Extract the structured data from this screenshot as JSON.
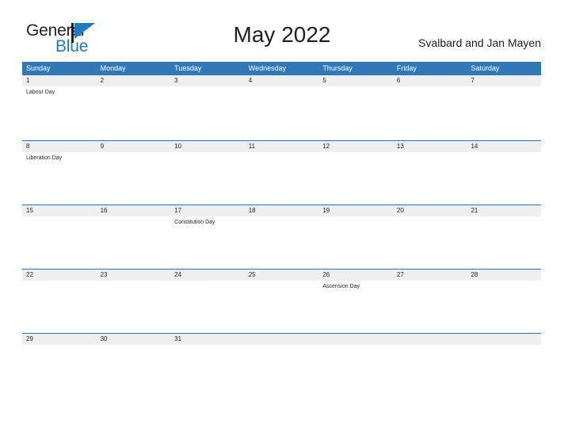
{
  "brand": {
    "name_part1": "General",
    "name_part2": "Blue",
    "flag_icon": "blue-flag-triangle-icon",
    "color_dark": "#231f20",
    "color_blue": "#1f7ac4"
  },
  "header": {
    "title": "May 2022",
    "region": "Svalbard and Jan Mayen"
  },
  "theme": {
    "header_blue": "#3079b6",
    "row_rule_blue": "#2e72ad",
    "daynum_background": "#efeff0",
    "page_background": "#ffffff",
    "text_color": "#231f20",
    "header_text_color": "#ffffff"
  },
  "calendar": {
    "weekdays": [
      "Sunday",
      "Monday",
      "Tuesday",
      "Wednesday",
      "Thursday",
      "Friday",
      "Saturday"
    ],
    "weeks": [
      {
        "days": [
          {
            "number": "1",
            "event": "Labour Day"
          },
          {
            "number": "2",
            "event": ""
          },
          {
            "number": "3",
            "event": ""
          },
          {
            "number": "4",
            "event": ""
          },
          {
            "number": "5",
            "event": ""
          },
          {
            "number": "6",
            "event": ""
          },
          {
            "number": "7",
            "event": ""
          }
        ]
      },
      {
        "days": [
          {
            "number": "8",
            "event": "Liberation Day"
          },
          {
            "number": "9",
            "event": ""
          },
          {
            "number": "10",
            "event": ""
          },
          {
            "number": "11",
            "event": ""
          },
          {
            "number": "12",
            "event": ""
          },
          {
            "number": "13",
            "event": ""
          },
          {
            "number": "14",
            "event": ""
          }
        ]
      },
      {
        "days": [
          {
            "number": "15",
            "event": ""
          },
          {
            "number": "16",
            "event": ""
          },
          {
            "number": "17",
            "event": "Constitution Day"
          },
          {
            "number": "18",
            "event": ""
          },
          {
            "number": "19",
            "event": ""
          },
          {
            "number": "20",
            "event": ""
          },
          {
            "number": "21",
            "event": ""
          }
        ]
      },
      {
        "days": [
          {
            "number": "22",
            "event": ""
          },
          {
            "number": "23",
            "event": ""
          },
          {
            "number": "24",
            "event": ""
          },
          {
            "number": "25",
            "event": ""
          },
          {
            "number": "26",
            "event": "Ascension Day"
          },
          {
            "number": "27",
            "event": ""
          },
          {
            "number": "28",
            "event": ""
          }
        ]
      },
      {
        "days": [
          {
            "number": "29",
            "event": ""
          },
          {
            "number": "30",
            "event": ""
          },
          {
            "number": "31",
            "event": ""
          },
          {
            "number": "",
            "event": ""
          },
          {
            "number": "",
            "event": ""
          },
          {
            "number": "",
            "event": ""
          },
          {
            "number": "",
            "event": ""
          }
        ]
      }
    ]
  }
}
